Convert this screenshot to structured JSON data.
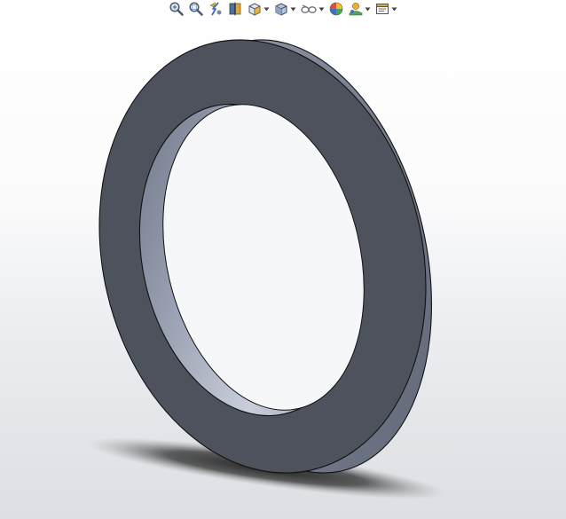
{
  "viewport": {
    "background_top": "#ffffff",
    "background_bottom": "#dcdfe3"
  },
  "toolbar": {
    "items": [
      {
        "icon": "zoom-to-fit-icon",
        "dropdown": false
      },
      {
        "icon": "zoom-to-area-icon",
        "dropdown": false
      },
      {
        "icon": "previous-view-icon",
        "dropdown": false
      },
      {
        "icon": "section-view-icon",
        "dropdown": false
      },
      {
        "icon": "view-orientation-icon",
        "dropdown": true
      },
      {
        "icon": "display-style-icon",
        "dropdown": true
      },
      {
        "icon": "hide-show-items-icon",
        "dropdown": true
      },
      {
        "icon": "edit-appearance-icon",
        "dropdown": false
      },
      {
        "icon": "apply-scene-icon",
        "dropdown": true
      },
      {
        "icon": "view-settings-icon",
        "dropdown": true
      }
    ]
  },
  "model": {
    "part": "washer",
    "face_color": "#4e525c",
    "side_color": "#858c9c",
    "highlight_color": "#c9cedb",
    "edge_color": "#111111",
    "shadow_color": "#2a2a2a"
  }
}
